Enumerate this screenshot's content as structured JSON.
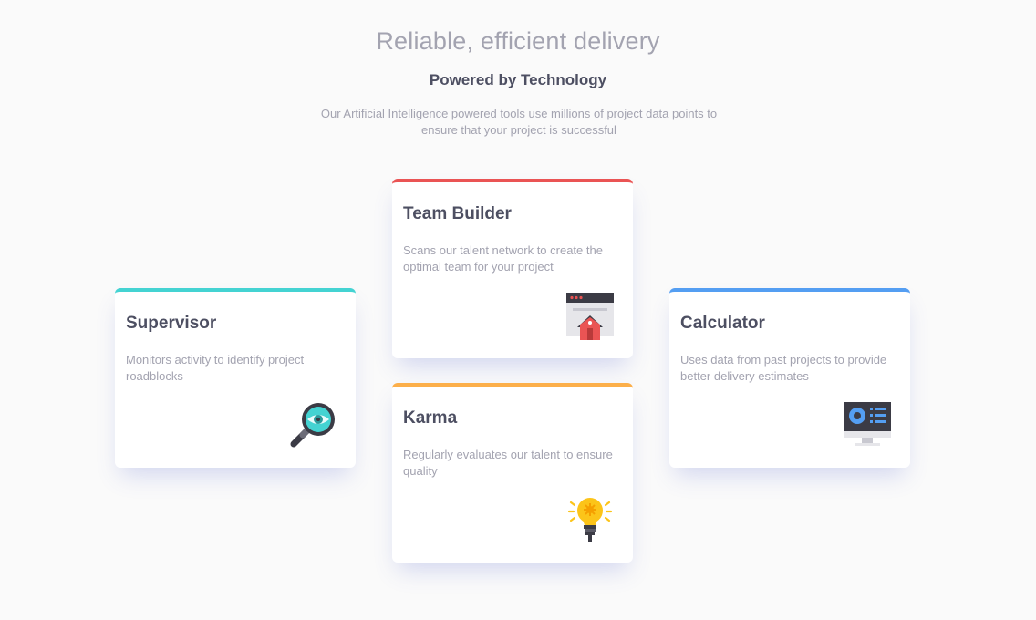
{
  "header": {
    "headline": "Reliable, efficient delivery",
    "subheadline": "Powered by Technology",
    "intro": "Our Artificial Intelligence powered tools use millions of project data points to ensure that your project is successful"
  },
  "cards": {
    "supervisor": {
      "title": "Supervisor",
      "description": "Monitors activity to identify project roadblocks",
      "icon": "magnifier-icon",
      "accent": "#44d3d2"
    },
    "team_builder": {
      "title": "Team Builder",
      "description": "Scans our talent network to create the optimal team for your project",
      "icon": "browser-house-icon",
      "accent": "#ea5454"
    },
    "karma": {
      "title": "Karma",
      "description": "Regularly evaluates our talent to ensure quality",
      "icon": "lightbulb-icon",
      "accent": "#fcaf4a"
    },
    "calculator": {
      "title": "Calculator",
      "description": "Uses data from past projects to provide better delivery estimates",
      "icon": "monitor-chart-icon",
      "accent": "#549ef2"
    }
  }
}
